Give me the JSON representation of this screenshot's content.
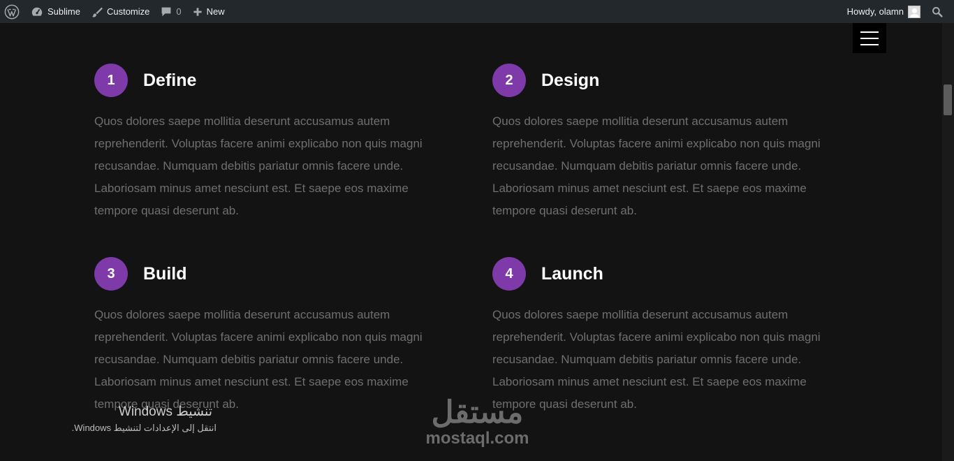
{
  "adminbar": {
    "wp_logo_icon": "wordpress-icon",
    "site_name": "Sublime",
    "customize_label": "Customize",
    "comments_count": "0",
    "new_label": "New",
    "howdy": "Howdy, olamn"
  },
  "steps": [
    {
      "number": "1",
      "title": "Define",
      "body": "Quos dolores saepe mollitia deserunt accusamus autem reprehenderit. Voluptas facere animi explicabo non quis magni recusandae. Numquam debitis pariatur omnis facere unde. Laboriosam minus amet nesciunt est. Et saepe eos maxime tempore quasi deserunt ab."
    },
    {
      "number": "2",
      "title": "Design",
      "body": "Quos dolores saepe mollitia deserunt accusamus autem reprehenderit. Voluptas facere animi explicabo non quis magni recusandae. Numquam debitis pariatur omnis facere unde. Laboriosam minus amet nesciunt est. Et saepe eos maxime tempore quasi deserunt ab."
    },
    {
      "number": "3",
      "title": "Build",
      "body": "Quos dolores saepe mollitia deserunt accusamus autem reprehenderit. Voluptas facere animi explicabo non quis magni recusandae. Numquam debitis pariatur omnis facere unde. Laboriosam minus amet nesciunt est. Et saepe eos maxime tempore quasi deserunt ab."
    },
    {
      "number": "4",
      "title": "Launch",
      "body": "Quos dolores saepe mollitia deserunt accusamus autem reprehenderit. Voluptas facere animi explicabo non quis magni recusandae. Numquam debitis pariatur omnis facere unde. Laboriosam minus amet nesciunt est. Et saepe eos maxime tempore quasi deserunt ab."
    }
  ],
  "windows_activation": {
    "title": "تنشيط Windows",
    "subtitle": "انتقل إلى الإعدادات لتنشيط Windows."
  },
  "watermark": {
    "arabic": "مستقل",
    "latin": "mostaql.com"
  },
  "colors": {
    "accent": "#7e3aa8",
    "background": "#131313",
    "adminbar": "#23282d"
  }
}
